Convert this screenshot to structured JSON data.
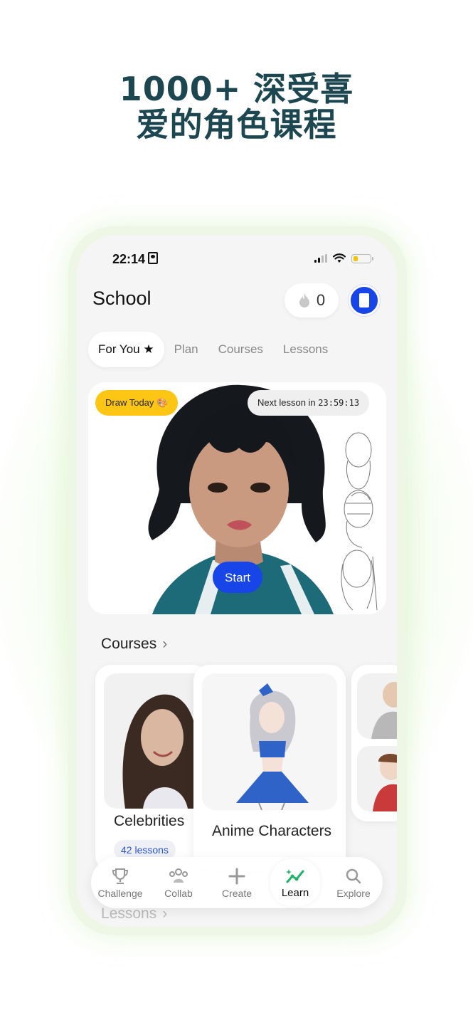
{
  "headline": {
    "line1": "1000+ 深受喜",
    "line2": "爱的角色课程"
  },
  "status": {
    "time": "22:14"
  },
  "header": {
    "title": "School",
    "streak_count": "0"
  },
  "tabs": [
    {
      "label": "For You ★",
      "active": true
    },
    {
      "label": "Plan",
      "active": false
    },
    {
      "label": "Courses",
      "active": false
    },
    {
      "label": "Lessons",
      "active": false
    }
  ],
  "hero": {
    "draw_today": "Draw Today 🎨",
    "next_lesson_label": "Next lesson in",
    "next_lesson_time": "23:59:13",
    "start_label": "Start"
  },
  "courses": {
    "heading": "Courses",
    "chevron": "›",
    "items": [
      {
        "title": "Celebrities",
        "lessons": "42 lessons"
      },
      {
        "title": "Anime Characters",
        "lessons": ""
      }
    ]
  },
  "lessons": {
    "heading": "Lessons",
    "chevron": "›"
  },
  "nav": [
    {
      "label": "Challenge",
      "icon": "trophy-icon"
    },
    {
      "label": "Collab",
      "icon": "people-icon"
    },
    {
      "label": "Create",
      "icon": "plus-icon"
    },
    {
      "label": "Learn",
      "icon": "learn-icon",
      "active": true
    },
    {
      "label": "Explore",
      "icon": "search-icon"
    }
  ],
  "colors": {
    "headline": "#1c4650",
    "accent": "#1745e8",
    "badge_yellow": "#fdc614",
    "chip_text": "#2c55d6"
  }
}
